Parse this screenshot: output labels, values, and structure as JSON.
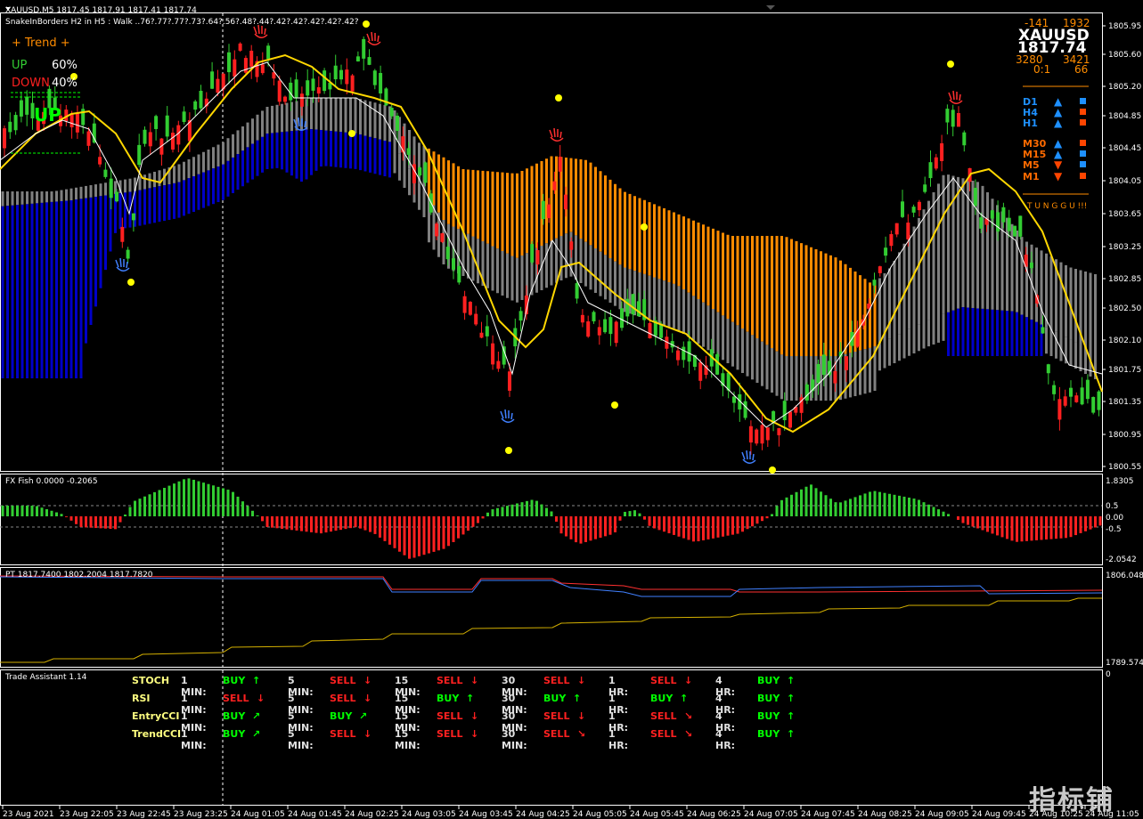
{
  "chart_header": {
    "symbol_line": "XAUUSD,M5  1817.45 1817.91 1817.41 1817.74",
    "indicator_line": "SnakeInBorders H2 in H5 :   Walk ..76?.77?.77?.73?.64?.56?.48?.44?.42?.42?.42?.42?.42?"
  },
  "trend_panel": {
    "title": "+   Trend   +",
    "up_label": "UP",
    "up_value": "60%",
    "down_label": "DOWN",
    "down_value": "40%",
    "arrow_text": "UP"
  },
  "price_box": {
    "left_top": "-141",
    "right_top": "1932",
    "symbol": "XAUUSD",
    "price": "1817.74",
    "left_mid": "3280",
    "right_mid": "3421",
    "ratio": "0:1",
    "right_bottom": "66"
  },
  "timeframes": [
    {
      "label": "D1",
      "dir": "▲",
      "color": "#1e90ff",
      "sq": "#1e90ff"
    },
    {
      "label": "H4",
      "dir": "▲",
      "color": "#1e90ff",
      "sq": "#ff4500"
    },
    {
      "label": "H1",
      "dir": "▲",
      "color": "#1e90ff",
      "sq": "#ff4500"
    },
    {
      "label": "M30",
      "dir": "▲",
      "color": "#ff6a00",
      "sq": "#ff4500"
    },
    {
      "label": "M15",
      "dir": "▲",
      "color": "#ff6a00",
      "sq": "#1e90ff"
    },
    {
      "label": "M5",
      "dir": "▼",
      "color": "#ff6a00",
      "sq": "#1e90ff"
    },
    {
      "label": "M1",
      "dir": "▼",
      "color": "#ff6a00",
      "sq": "#ff4500"
    }
  ],
  "wait_label": "T U N G G U !!!",
  "price_axis": [
    "1805.95",
    "1805.60",
    "1805.20",
    "1804.85",
    "1804.45",
    "1804.05",
    "1803.65",
    "1803.25",
    "1802.85",
    "1802.50",
    "1802.10",
    "1801.75",
    "1801.35",
    "1800.95",
    "1800.55"
  ],
  "fish": {
    "label": "FX Fish 0.0000 -0.2065",
    "axis": [
      "1.8305",
      "0.5",
      "0.00",
      "-0.5",
      "-2.0542"
    ]
  },
  "pt": {
    "label": "PT 1817.7400 1802.2004 1817.7820",
    "axis": [
      "1806.0488",
      "1789.5741"
    ]
  },
  "trade_assistant": {
    "label": "Trade Assistant 1.14",
    "axis": "0",
    "rows": [
      {
        "name": "STOCH",
        "cells": [
          {
            "tf": "1 MIN:",
            "sig": "BUY",
            "arrow": "↑"
          },
          {
            "tf": "5 MIN:",
            "sig": "SELL",
            "arrow": "↓"
          },
          {
            "tf": "15 MIN:",
            "sig": "SELL",
            "arrow": "↓"
          },
          {
            "tf": "30 MIN:",
            "sig": "SELL",
            "arrow": "↓"
          },
          {
            "tf": "1 HR:",
            "sig": "SELL",
            "arrow": "↓"
          },
          {
            "tf": "4 HR:",
            "sig": "BUY",
            "arrow": "↑"
          }
        ]
      },
      {
        "name": "RSI",
        "cells": [
          {
            "tf": "1 MIN:",
            "sig": "SELL",
            "arrow": "↓"
          },
          {
            "tf": "5 MIN:",
            "sig": "SELL",
            "arrow": "↓"
          },
          {
            "tf": "15 MIN:",
            "sig": "BUY",
            "arrow": "↑"
          },
          {
            "tf": "30 MIN:",
            "sig": "BUY",
            "arrow": "↑"
          },
          {
            "tf": "1 HR:",
            "sig": "BUY",
            "arrow": "↑"
          },
          {
            "tf": "4 HR:",
            "sig": "BUY",
            "arrow": "↑"
          }
        ]
      },
      {
        "name": "EntryCCI",
        "cells": [
          {
            "tf": "1 MIN:",
            "sig": "BUY",
            "arrow": "↗"
          },
          {
            "tf": "5 MIN:",
            "sig": "BUY",
            "arrow": "↗"
          },
          {
            "tf": "15 MIN:",
            "sig": "SELL",
            "arrow": "↓"
          },
          {
            "tf": "30 MIN:",
            "sig": "SELL",
            "arrow": "↓"
          },
          {
            "tf": "1 HR:",
            "sig": "SELL",
            "arrow": "↘"
          },
          {
            "tf": "4 HR:",
            "sig": "BUY",
            "arrow": "↑"
          }
        ]
      },
      {
        "name": "TrendCCI",
        "cells": [
          {
            "tf": "1 MIN:",
            "sig": "BUY",
            "arrow": "↗"
          },
          {
            "tf": "5 MIN:",
            "sig": "SELL",
            "arrow": "↓"
          },
          {
            "tf": "15 MIN:",
            "sig": "SELL",
            "arrow": "↓"
          },
          {
            "tf": "30 MIN:",
            "sig": "SELL",
            "arrow": "↘"
          },
          {
            "tf": "1 HR:",
            "sig": "SELL",
            "arrow": "↘"
          },
          {
            "tf": "4 HR:",
            "sig": "BUY",
            "arrow": "↑"
          }
        ]
      }
    ]
  },
  "time_axis": [
    "23 Aug 2021",
    "23 Aug 22:05",
    "23 Aug 22:45",
    "23 Aug 23:25",
    "24 Aug 01:05",
    "24 Aug 01:45",
    "24 Aug 02:25",
    "24 Aug 03:05",
    "24 Aug 03:45",
    "24 Aug 04:25",
    "24 Aug 05:05",
    "24 Aug 05:45",
    "24 Aug 06:25",
    "24 Aug 07:05",
    "24 Aug 07:45",
    "24 Aug 08:25",
    "24 Aug 09:05",
    "24 Aug 09:45",
    "24 Aug 10:25",
    "24 Aug 11:05"
  ],
  "watermark": "指标铺",
  "colors": {
    "buy": "#00ff00",
    "sell": "#ff2020",
    "bull": "#32cd32",
    "bear": "#ff2020",
    "ma_slow": "#ffd700",
    "ma_fast": "#ffffff",
    "band_blue": "#0000c8",
    "band_orange": "#ff8c00",
    "band_gray": "#808080"
  }
}
